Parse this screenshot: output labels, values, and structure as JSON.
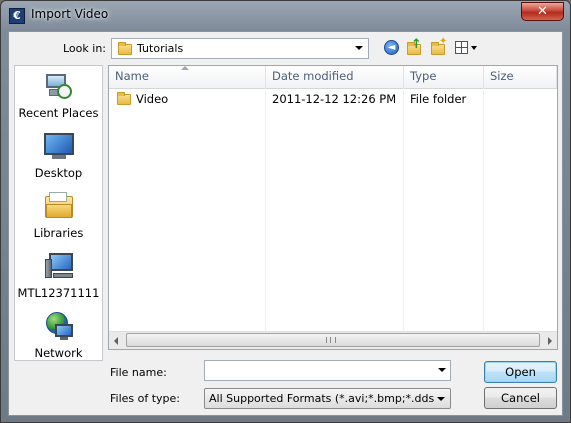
{
  "window": {
    "title": "Import Video",
    "app_icon_glyph": "€",
    "close_glyph": "✕"
  },
  "toolbar": {
    "look_in_label": "Look in:",
    "look_in_value": "Tutorials",
    "icons": [
      "back-icon",
      "up-folder-icon",
      "new-folder-icon",
      "views-menu-icon"
    ]
  },
  "places": [
    {
      "label": "Recent Places",
      "icon": "recent-places-icon"
    },
    {
      "label": "Desktop",
      "icon": "desktop-icon"
    },
    {
      "label": "Libraries",
      "icon": "libraries-icon"
    },
    {
      "label": "MTL12371111",
      "icon": "computer-icon"
    },
    {
      "label": "Network",
      "icon": "network-icon"
    }
  ],
  "file_list": {
    "columns": [
      "Name",
      "Date modified",
      "Type",
      "Size"
    ],
    "rows": [
      {
        "name": "Video",
        "date": "2011-12-12 12:26 PM",
        "type": "File folder",
        "size": ""
      }
    ]
  },
  "form": {
    "file_name_label": "File name:",
    "file_name_value": "",
    "file_type_label": "Files of type:",
    "file_type_value": "All Supported Formats (*.avi;*.bmp;*.dds;*.iff;*.jp"
  },
  "buttons": {
    "open": "Open",
    "cancel": "Cancel"
  },
  "colors": {
    "close_button": "#c9493a",
    "default_button": "#a7d7f5",
    "header_text": "#4c607a"
  }
}
